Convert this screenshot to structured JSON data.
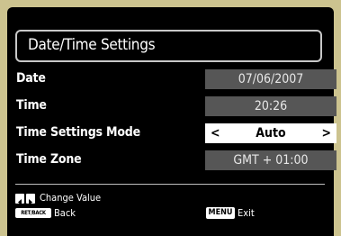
{
  "dialog": {
    "title": "Date/Time Settings"
  },
  "rows": [
    {
      "label": "Date",
      "value": "07/06/2007"
    },
    {
      "label": "Time",
      "value": "20:26"
    },
    {
      "label": "Time Settings Mode",
      "value": "Auto"
    },
    {
      "label": "Time Zone",
      "value": "GMT + 01:00"
    }
  ],
  "selector": {
    "left_arrow": "<",
    "right_arrow": ">"
  },
  "hints": {
    "change_value": "Change Value",
    "back_key": "RET/BACK",
    "back": "Back",
    "menu_key": "MENU",
    "exit": "Exit"
  },
  "colors": {
    "background": "#ccc38f",
    "panel": "#000000",
    "value_field": "#565656",
    "selected_field": "#ffffff"
  }
}
